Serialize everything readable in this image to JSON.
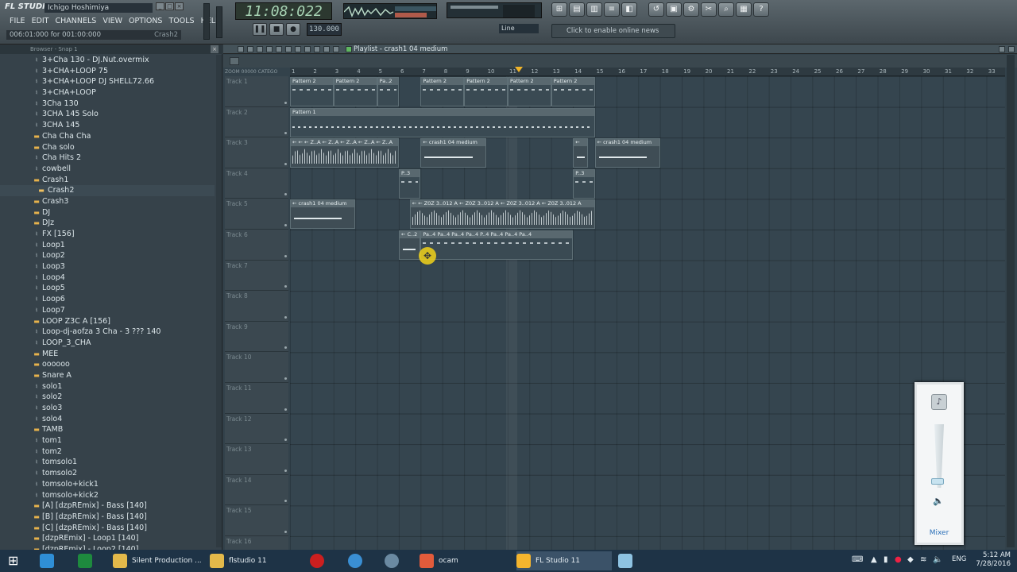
{
  "app": {
    "logo": "FL STUDIO",
    "user": "Ichigo Hoshimiya"
  },
  "menu": [
    "FILE",
    "EDIT",
    "CHANNELS",
    "VIEW",
    "OPTIONS",
    "TOOLS",
    "HELP"
  ],
  "hint": {
    "text": "006:01:000 for 001:00:000",
    "right": "Crash2"
  },
  "clock": "11:08:022",
  "tempo": "130.000",
  "line_select": "Line",
  "news": "Click to enable online news",
  "browser": {
    "title": "Browser - Snap 1",
    "items": [
      {
        "label": "3+Cha 130 - DJ.Nut.overmix",
        "type": "file"
      },
      {
        "label": "3+CHA+LOOP 75",
        "type": "file"
      },
      {
        "label": "3+CHA+LOOP  DJ SHELL72.66",
        "type": "file"
      },
      {
        "label": "3+CHA+LOOP",
        "type": "file"
      },
      {
        "label": "3Cha 130",
        "type": "file"
      },
      {
        "label": "3CHA 145 Solo",
        "type": "file"
      },
      {
        "label": "3CHA  145",
        "type": "file"
      },
      {
        "label": "Cha  Cha  Cha",
        "type": "folder"
      },
      {
        "label": "Cha  solo",
        "type": "folder"
      },
      {
        "label": "Cha Hits 2",
        "type": "file"
      },
      {
        "label": "cowbell",
        "type": "file"
      },
      {
        "label": "Crash1",
        "type": "folder"
      },
      {
        "label": "Crash2",
        "type": "folder",
        "selected": true
      },
      {
        "label": "Crash3",
        "type": "folder"
      },
      {
        "label": "DJ",
        "type": "folder"
      },
      {
        "label": "DJz",
        "type": "folder"
      },
      {
        "label": "FX   [156]",
        "type": "file"
      },
      {
        "label": "Loop1",
        "type": "file"
      },
      {
        "label": "Loop2",
        "type": "file"
      },
      {
        "label": "Loop3",
        "type": "file"
      },
      {
        "label": "Loop4",
        "type": "file"
      },
      {
        "label": "Loop5",
        "type": "file"
      },
      {
        "label": "Loop6",
        "type": "file"
      },
      {
        "label": "Loop7",
        "type": "file"
      },
      {
        "label": "LOOP Z3C A [156]",
        "type": "folder"
      },
      {
        "label": "Loop-dj-aofza 3 Cha - 3 ??? 140",
        "type": "file"
      },
      {
        "label": "LOOP_3_CHA",
        "type": "file"
      },
      {
        "label": "MEE",
        "type": "folder"
      },
      {
        "label": "oooooo",
        "type": "folder"
      },
      {
        "label": "Snare A",
        "type": "folder"
      },
      {
        "label": "solo1",
        "type": "file"
      },
      {
        "label": "solo2",
        "type": "file"
      },
      {
        "label": "solo3",
        "type": "file"
      },
      {
        "label": "solo4",
        "type": "file"
      },
      {
        "label": "TAMB",
        "type": "folder"
      },
      {
        "label": "tom1",
        "type": "file"
      },
      {
        "label": "tom2",
        "type": "file"
      },
      {
        "label": "tomsolo1",
        "type": "file"
      },
      {
        "label": "tomsolo2",
        "type": "file"
      },
      {
        "label": "tomsolo+kick1",
        "type": "file"
      },
      {
        "label": "tomsolo+kick2",
        "type": "file"
      },
      {
        "label": "[A] [dzpREmix] - Bass [140]",
        "type": "folder"
      },
      {
        "label": "[B] [dzpREmix] - Bass [140]",
        "type": "folder"
      },
      {
        "label": "[C] [dzpREmix] - Bass [140]",
        "type": "folder"
      },
      {
        "label": "[dzpREmix] - Loop1 [140]",
        "type": "folder"
      },
      {
        "label": "[dzpREmix] - Loop2 [140]",
        "type": "folder"
      }
    ]
  },
  "playlist": {
    "title": "Playlist - crash1 04 medium",
    "zoom_label": "ZOOM 00000   CATEGO",
    "ruler": [
      "1",
      "2",
      "3",
      "4",
      "5",
      "6",
      "7",
      "8",
      "9",
      "10",
      "11",
      "12",
      "13",
      "14",
      "15",
      "16",
      "17",
      "18",
      "19",
      "20",
      "21",
      "22",
      "23",
      "24",
      "25",
      "26",
      "27",
      "28",
      "29",
      "30",
      "31",
      "32",
      "33"
    ],
    "tracks": [
      "Track 1",
      "Track 2",
      "Track 3",
      "Track 4",
      "Track 5",
      "Track 6",
      "Track 7",
      "Track 8",
      "Track 9",
      "Track 10",
      "Track 11",
      "Track 12",
      "Track 13",
      "Track 14",
      "Track 15",
      "Track 16"
    ],
    "clips": [
      {
        "track": 0,
        "label": "Pattern 2",
        "start": 0,
        "len": 2,
        "kind": "pat"
      },
      {
        "track": 0,
        "label": "Pattern 2",
        "start": 2,
        "len": 2,
        "kind": "pat"
      },
      {
        "track": 0,
        "label": "Pa..2",
        "start": 4,
        "len": 1,
        "kind": "pat"
      },
      {
        "track": 0,
        "label": "Pattern 2",
        "start": 6,
        "len": 2,
        "kind": "pat"
      },
      {
        "track": 0,
        "label": "Pattern 2",
        "start": 8,
        "len": 2,
        "kind": "pat"
      },
      {
        "track": 0,
        "label": "Pattern 2",
        "start": 10,
        "len": 2,
        "kind": "pat"
      },
      {
        "track": 0,
        "label": "Pattern 2",
        "start": 12,
        "len": 2,
        "kind": "pat"
      },
      {
        "track": 1,
        "label": "Pattern 1",
        "start": 0,
        "len": 14,
        "kind": "pat"
      },
      {
        "track": 2,
        "label": "← ← ← Z..A ← Z..A ← Z..A ← Z..A ← Z..A",
        "start": 0,
        "len": 5,
        "kind": "audio"
      },
      {
        "track": 2,
        "label": "← crash1 04 medium",
        "start": 6,
        "len": 3,
        "kind": "flat"
      },
      {
        "track": 2,
        "label": "←",
        "start": 13,
        "len": 0.7,
        "kind": "flat"
      },
      {
        "track": 2,
        "label": "← crash1 04 medium",
        "start": 14,
        "len": 3,
        "kind": "flat"
      },
      {
        "track": 3,
        "label": "P..3",
        "start": 5,
        "len": 1,
        "kind": "pat"
      },
      {
        "track": 3,
        "label": "P..3",
        "start": 13,
        "len": 1,
        "kind": "pat"
      },
      {
        "track": 4,
        "label": "← crash1 04 medium",
        "start": 0,
        "len": 3,
        "kind": "flat"
      },
      {
        "track": 4,
        "label": "← ← Z0Z 3..012 A ← Z0Z 3..012 A ← Z0Z 3..012 A ← Z0Z 3..012 A",
        "start": 5.5,
        "len": 8.5,
        "kind": "audio"
      },
      {
        "track": 5,
        "label": "← C..2",
        "start": 5,
        "len": 1,
        "kind": "flat"
      },
      {
        "track": 5,
        "label": "Pa..4 Pa..4 Pa..4 Pa..4 P..4 Pa..4 Pa..4 Pa..4",
        "start": 6,
        "len": 7,
        "kind": "pat"
      }
    ]
  },
  "volume_popup": {
    "mixer_label": "Mixer"
  },
  "taskbar": {
    "items": [
      "Silent Production ...",
      "flstudio 11",
      "ocam",
      "FL Studio 11"
    ],
    "lang": "ENG",
    "time": "5:12 AM",
    "date": "7/28/2016"
  }
}
